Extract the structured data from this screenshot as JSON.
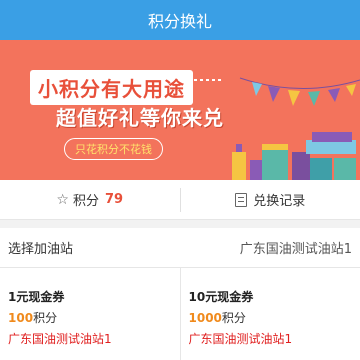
{
  "header": {
    "title": "积分换礼"
  },
  "banner": {
    "line1": "小积分有大用途",
    "line2": "超值好礼等你来兑",
    "line3": "只花积分不花钱"
  },
  "points": {
    "label": "积分",
    "value": "79",
    "record_label": "兑换记录"
  },
  "station": {
    "label": "选择加油站",
    "value": "广东国油测试油站1"
  },
  "coupons": [
    {
      "title": "1元现金券",
      "points": "100",
      "points_unit": "积分",
      "station": "广东国油测试油站1"
    },
    {
      "title": "10元现金券",
      "points": "1000",
      "points_unit": "积分",
      "station": "广东国油测试油站1"
    }
  ],
  "colors": {
    "header": "#3a9fe5",
    "banner": "#f3735c",
    "accent_red": "#e8503a",
    "points_orange": "#f08a1c"
  }
}
